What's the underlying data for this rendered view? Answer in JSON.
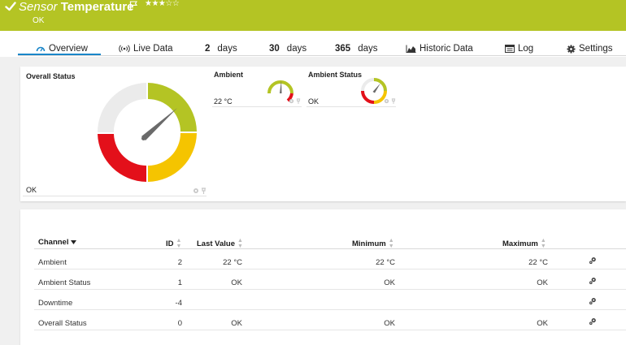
{
  "header": {
    "sensor_type": "Sensor",
    "sensor_name": "Temperature",
    "stars": "★★★☆☆",
    "status": "OK",
    "bg_color": "#b4c424"
  },
  "tabs": [
    {
      "label": "Overview",
      "icon": "overview-gauge-icon",
      "active": true
    },
    {
      "label": "Live Data",
      "icon": "live-data-icon"
    },
    {
      "num": "2",
      "label": "days"
    },
    {
      "num": "30",
      "label": "days"
    },
    {
      "num": "365",
      "label": "days"
    },
    {
      "label": "Historic Data",
      "icon": "area-chart-icon"
    },
    {
      "label": "Log",
      "icon": "log-icon"
    },
    {
      "label": "Settings",
      "icon": "gear-icon"
    }
  ],
  "gauges": {
    "overall": {
      "title": "Overall Status",
      "value": "OK"
    },
    "ambient": {
      "title": "Ambient",
      "value": "22 °C"
    },
    "ambient_status": {
      "title": "Ambient Status",
      "value": "OK"
    }
  },
  "table": {
    "headers": {
      "channel": "Channel",
      "id": "ID",
      "last_value": "Last Value",
      "minimum": "Minimum",
      "maximum": "Maximum"
    },
    "rows": [
      {
        "channel": "Ambient",
        "id": "2",
        "last": "22 °C",
        "min": "22 °C",
        "max": "22 °C"
      },
      {
        "channel": "Ambient Status",
        "id": "1",
        "last": "OK",
        "min": "OK",
        "max": "OK"
      },
      {
        "channel": "Downtime",
        "id": "-4",
        "last": "",
        "min": "",
        "max": ""
      },
      {
        "channel": "Overall Status",
        "id": "0",
        "last": "OK",
        "min": "OK",
        "max": "OK"
      }
    ]
  },
  "colors": {
    "accent": "#1a86c9",
    "ok_green": "#b4c424",
    "warning_yellow": "#f5c400",
    "error_red": "#e3101a",
    "neutral_gray": "#ebebeb"
  }
}
